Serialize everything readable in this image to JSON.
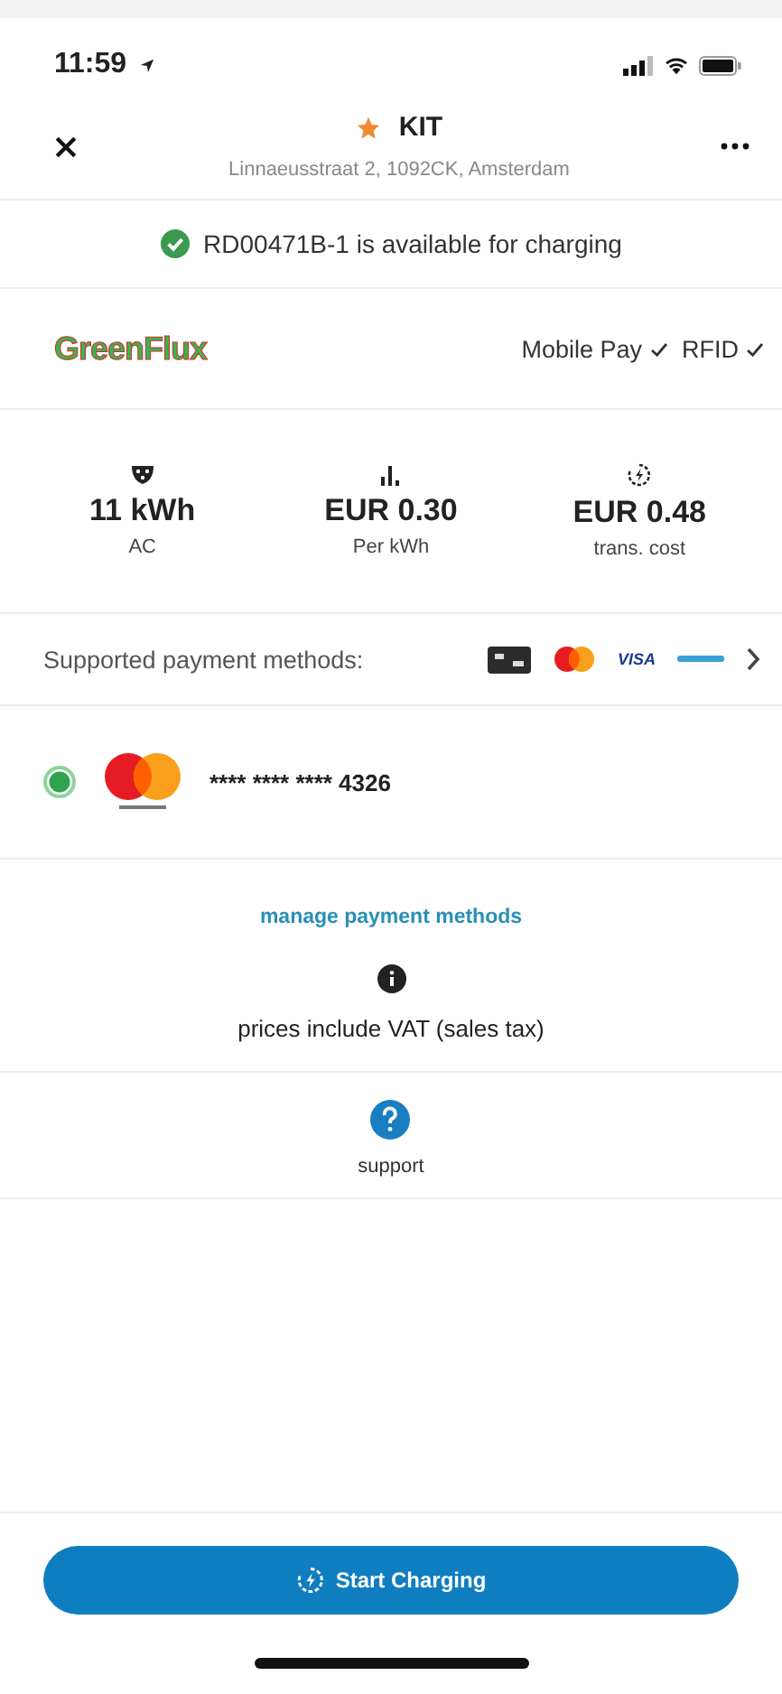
{
  "status_bar": {
    "time": "11:59"
  },
  "header": {
    "title": "KIT",
    "favorite": true,
    "address": "Linnaeusstraat 2, 1092CK, Amsterdam"
  },
  "availability": {
    "text": "RD00471B-1 is available for charging",
    "available": true
  },
  "operator": {
    "logo_text": "GreenFlux",
    "features": [
      {
        "label": "Mobile Pay",
        "supported": true
      },
      {
        "label": "RFID",
        "supported": true
      }
    ]
  },
  "stats": [
    {
      "kind": "power",
      "value": "11 kWh",
      "label": "AC"
    },
    {
      "kind": "price",
      "value": "EUR 0.30",
      "label": "Per kWh"
    },
    {
      "kind": "transaction",
      "value": "EUR 0.48",
      "label": "trans. cost"
    }
  ],
  "payment_methods": {
    "label": "Supported payment methods:",
    "methods": [
      {
        "kind": "card"
      },
      {
        "kind": "mastercard"
      },
      {
        "kind": "visa",
        "label": "VISA"
      },
      {
        "kind": "bank"
      }
    ]
  },
  "cards": [
    {
      "kind": "mastercard",
      "number": "**** **** **** 4326",
      "selected": true
    }
  ],
  "manage_link": "manage payment methods",
  "vat_note": "prices include VAT (sales tax)",
  "support": "support",
  "start_button": "Start Charging"
}
